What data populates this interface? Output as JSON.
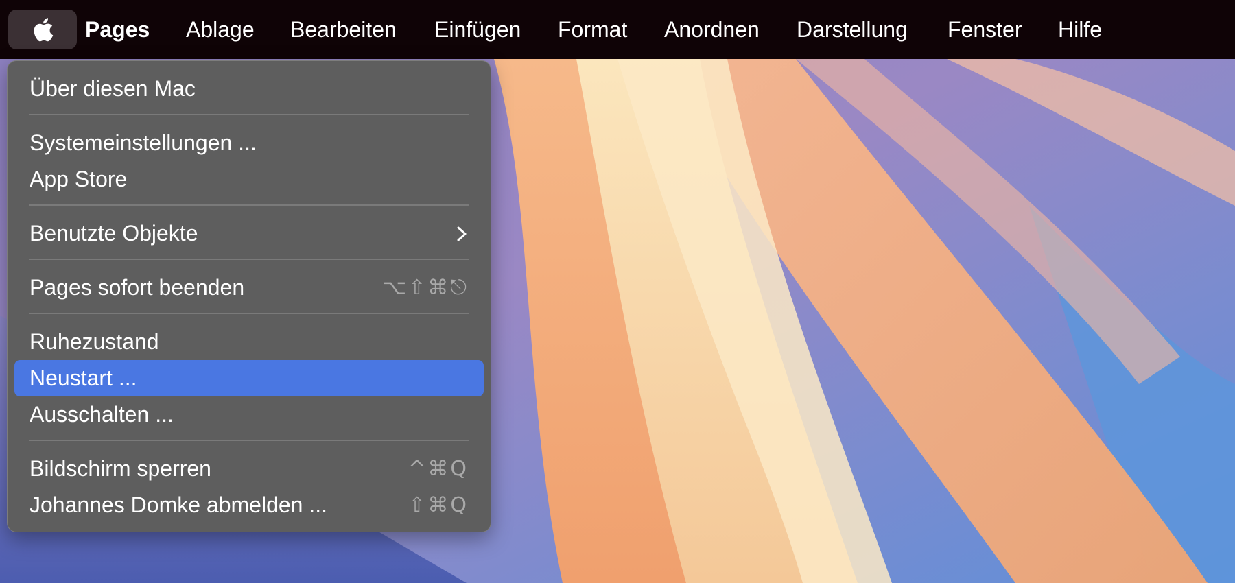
{
  "menubar": {
    "apple_icon": "apple-logo-icon",
    "app_name": "Pages",
    "menus": [
      "Ablage",
      "Bearbeiten",
      "Einfügen",
      "Format",
      "Anordnen",
      "Darstellung",
      "Fenster",
      "Hilfe"
    ]
  },
  "apple_menu": {
    "items": [
      {
        "label": "Über diesen Mac"
      },
      {
        "label": "Systemeinstellungen ..."
      },
      {
        "label": "App Store"
      },
      {
        "label": "Benutzte Objekte",
        "submenu_icon": "chevron-right-icon"
      },
      {
        "label": "Pages sofort beenden",
        "shortcut": "⌥⇧⌘⎋"
      },
      {
        "label": "Ruhezustand"
      },
      {
        "label": "Neustart ...",
        "state": "highlighted"
      },
      {
        "label": "Ausschalten ..."
      },
      {
        "label": "Bildschirm sperren",
        "shortcut": "^⌘Q"
      },
      {
        "label": "Johannes Domke abmelden ...",
        "shortcut": "⇧⌘Q"
      }
    ]
  },
  "colors": {
    "menubar_bg": "#0f0306",
    "menu_bg": "#5e5e5e",
    "highlight": "#4a77e2",
    "shortcut_text": "#a9a9a9"
  }
}
